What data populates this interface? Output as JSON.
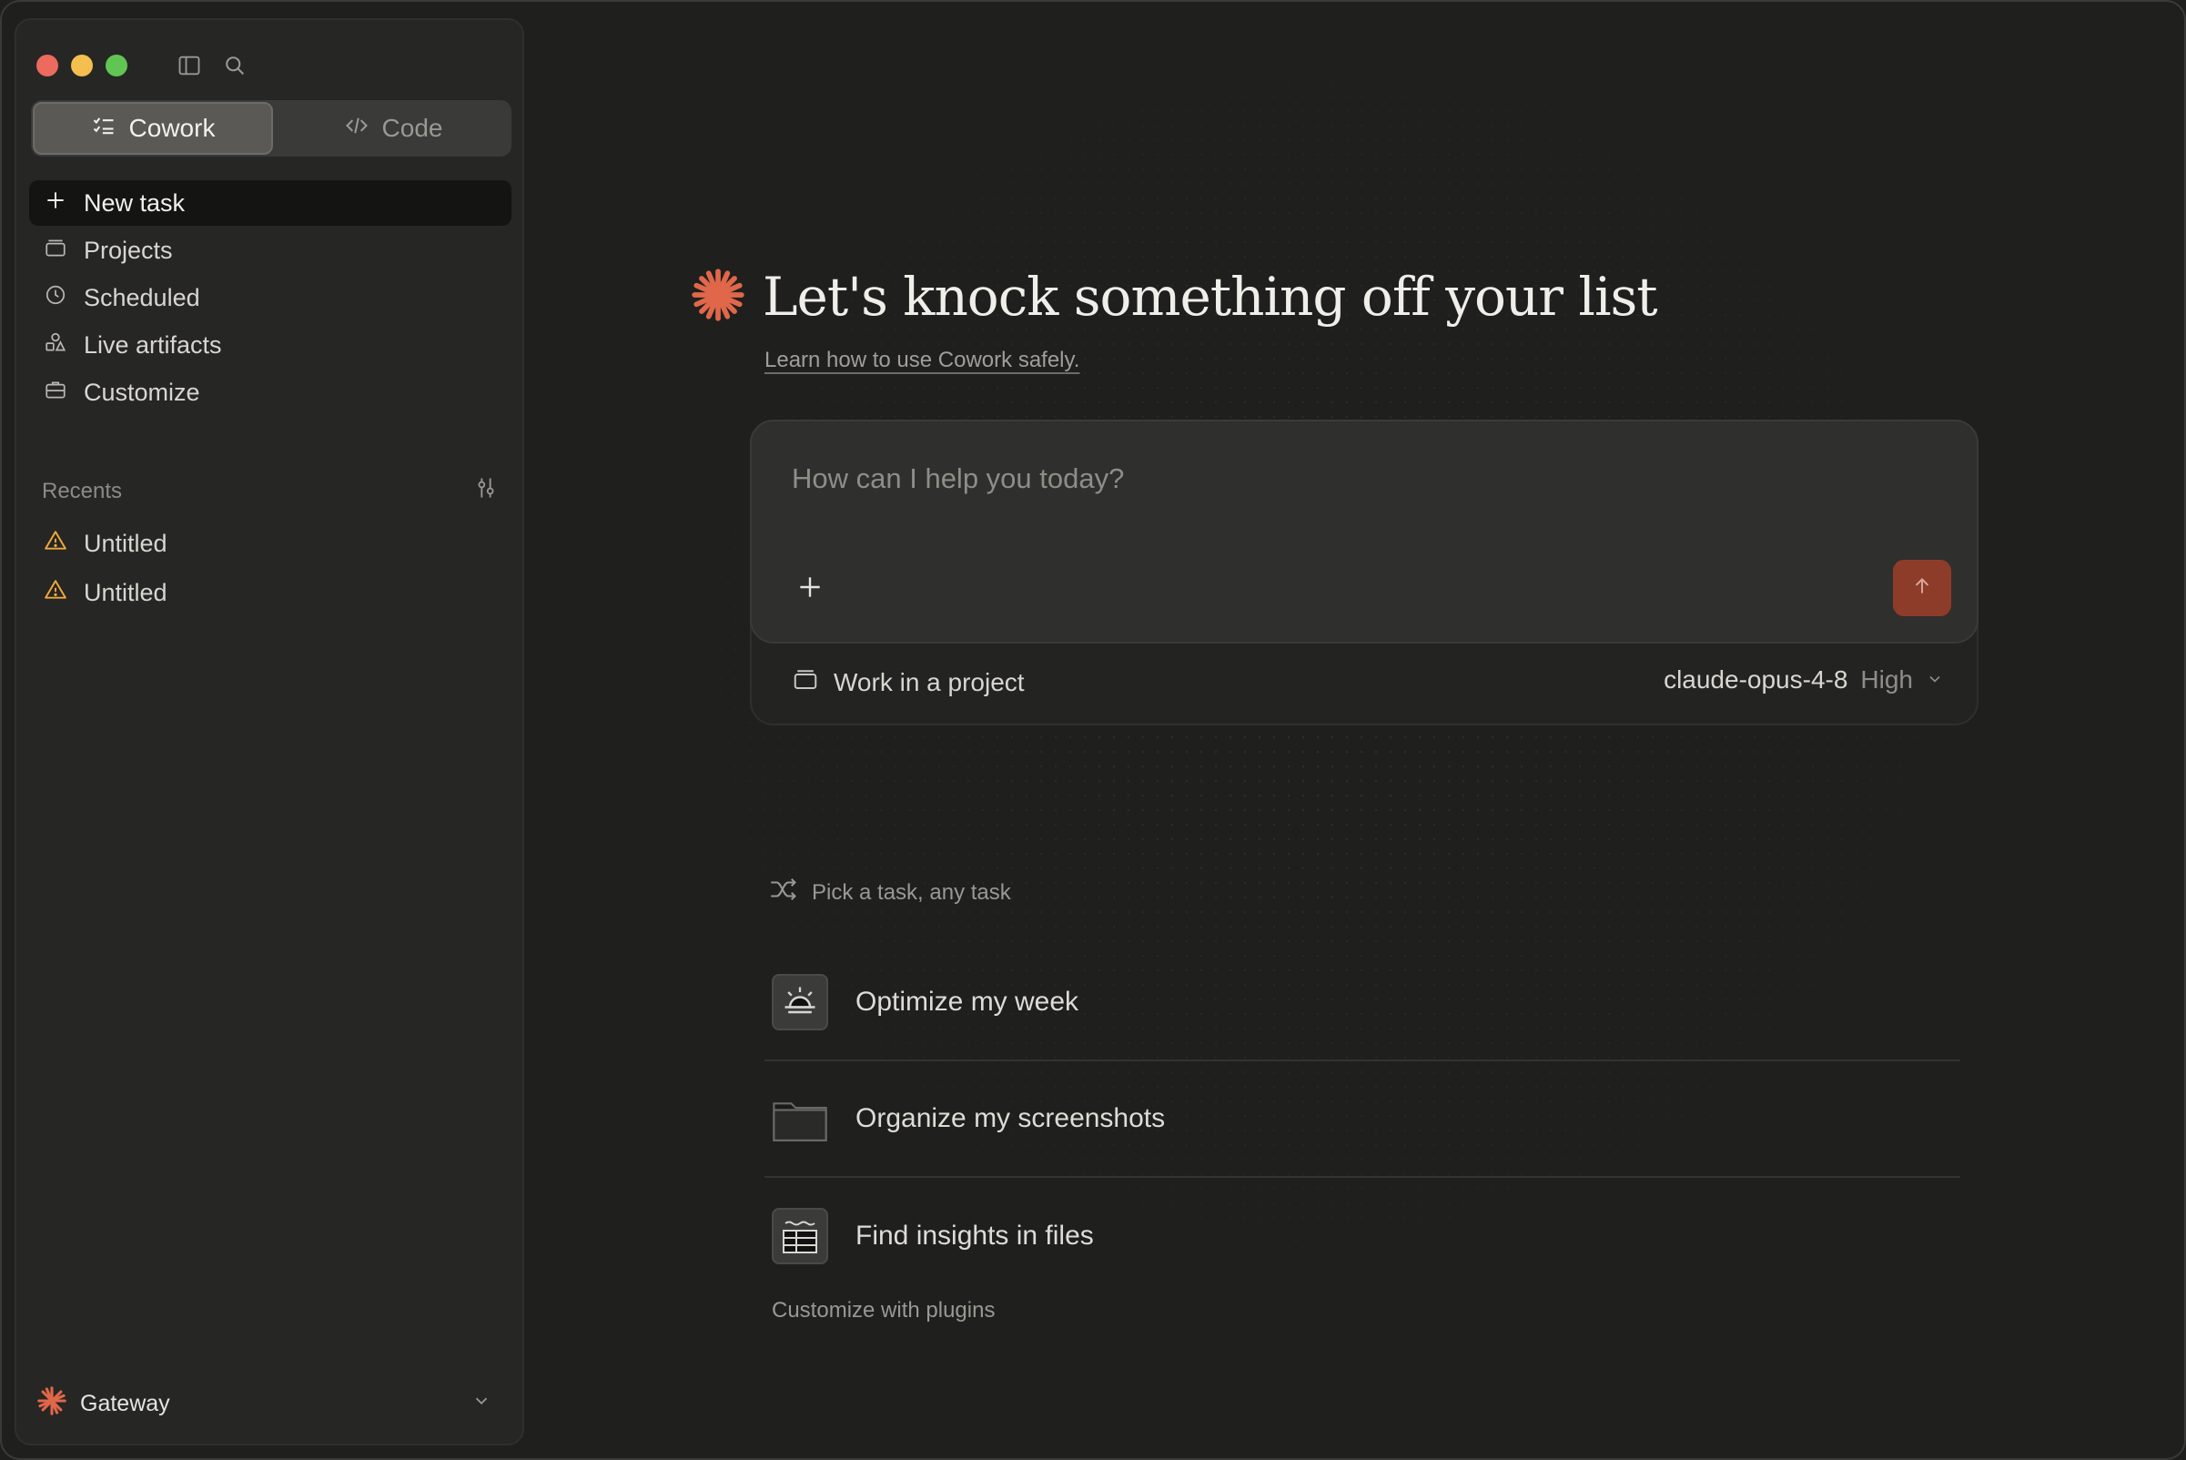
{
  "sidebar": {
    "mode_tabs": [
      {
        "label": "Cowork",
        "active": true
      },
      {
        "label": "Code",
        "active": false
      }
    ],
    "nav_items": [
      {
        "label": "New task",
        "icon": "plus-icon"
      },
      {
        "label": "Projects",
        "icon": "folder-stack-icon"
      },
      {
        "label": "Scheduled",
        "icon": "clock-icon"
      },
      {
        "label": "Live artifacts",
        "icon": "shapes-icon"
      },
      {
        "label": "Customize",
        "icon": "briefcase-icon"
      }
    ],
    "recents_label": "Recents",
    "recents": [
      {
        "label": "Untitled",
        "icon": "warning-icon"
      },
      {
        "label": "Untitled",
        "icon": "warning-icon"
      }
    ],
    "account": {
      "label": "Gateway"
    }
  },
  "main": {
    "title": "Let's knock something off your list",
    "learn_link": "Learn how to use Cowork safely.",
    "composer": {
      "placeholder": "How can I help you today?",
      "project_label": "Work in a project",
      "model": "claude-opus-4-8",
      "effort": "High"
    },
    "pick_label": "Pick a task, any task",
    "tasks": [
      {
        "label": "Optimize my week"
      },
      {
        "label": "Organize my screenshots"
      },
      {
        "label": "Find insights in files"
      }
    ],
    "plugins_link": "Customize with plugins"
  },
  "colors": {
    "accent": "#e0674a",
    "send_button": "#8e3c2a",
    "warning": "#f0a93b",
    "background": "#1f1f1e",
    "sidebar": "#262625"
  }
}
